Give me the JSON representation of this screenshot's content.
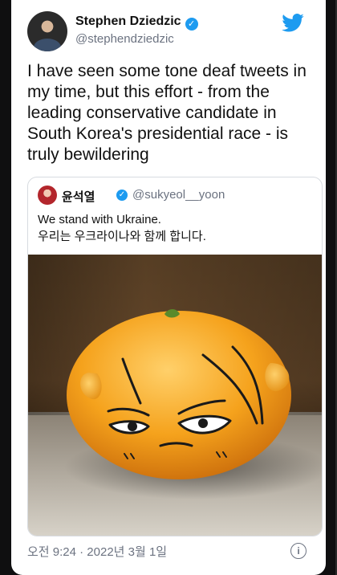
{
  "tweet": {
    "author": {
      "name": "Stephen Dziedzic",
      "handle": "@stephendziedzic",
      "verified_mark": "✓"
    },
    "text": "I have seen some tone deaf tweets in my time, but this effort - from the leading conservative candidate in South Korea's presidential race - is truly bewildering",
    "timestamp": "오전 9:24 · 2022년 3월 1일",
    "info_icon_glyph": "i"
  },
  "quoted_tweet": {
    "author": {
      "name": "윤석열",
      "handle": "@sukyeol__yoon",
      "verified_mark": "✓"
    },
    "text_line1": "We stand with Ukraine.",
    "text_line2": "우리는 우크라이나와 함께 합니다."
  },
  "colors": {
    "accent": "#1d9bf0",
    "text": "#111111",
    "secondary_text": "#6b7280",
    "background": "#ffffff"
  },
  "icons": {
    "brand": "twitter-bird-icon",
    "verified": "verified-badge-icon",
    "info": "info-icon"
  }
}
